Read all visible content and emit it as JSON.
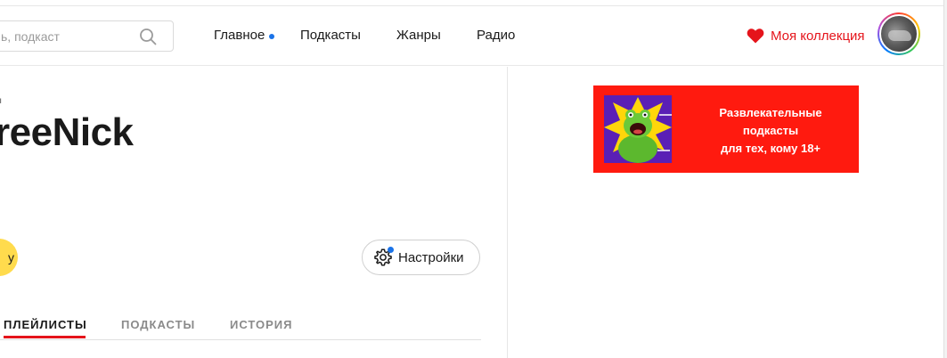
{
  "search": {
    "placeholder": "ь, подкаст"
  },
  "nav": {
    "home_label": "Главное",
    "podcasts_label": "Подкасты",
    "genres_label": "Жанры",
    "radio_label": "Радио"
  },
  "collection": {
    "label": "Моя коллекция"
  },
  "profile": {
    "kicker": "я",
    "name": "reeNick",
    "action_label": "у"
  },
  "settings": {
    "label": "Настройки"
  },
  "tabs": [
    {
      "label": "ПЛЕЙЛИСТЫ",
      "active": true
    },
    {
      "label": "ПОДКАСТЫ",
      "active": false
    },
    {
      "label": "ИСТОРИЯ",
      "active": false
    }
  ],
  "banner": {
    "lines": [
      "Развлекательные",
      "подкасты",
      "для тех, кому 18+"
    ]
  },
  "colors": {
    "accent_red": "#e5141b",
    "banner_red": "#ff1a0f",
    "yellow": "#ffdb4d",
    "notify_blue": "#1a73e8"
  }
}
